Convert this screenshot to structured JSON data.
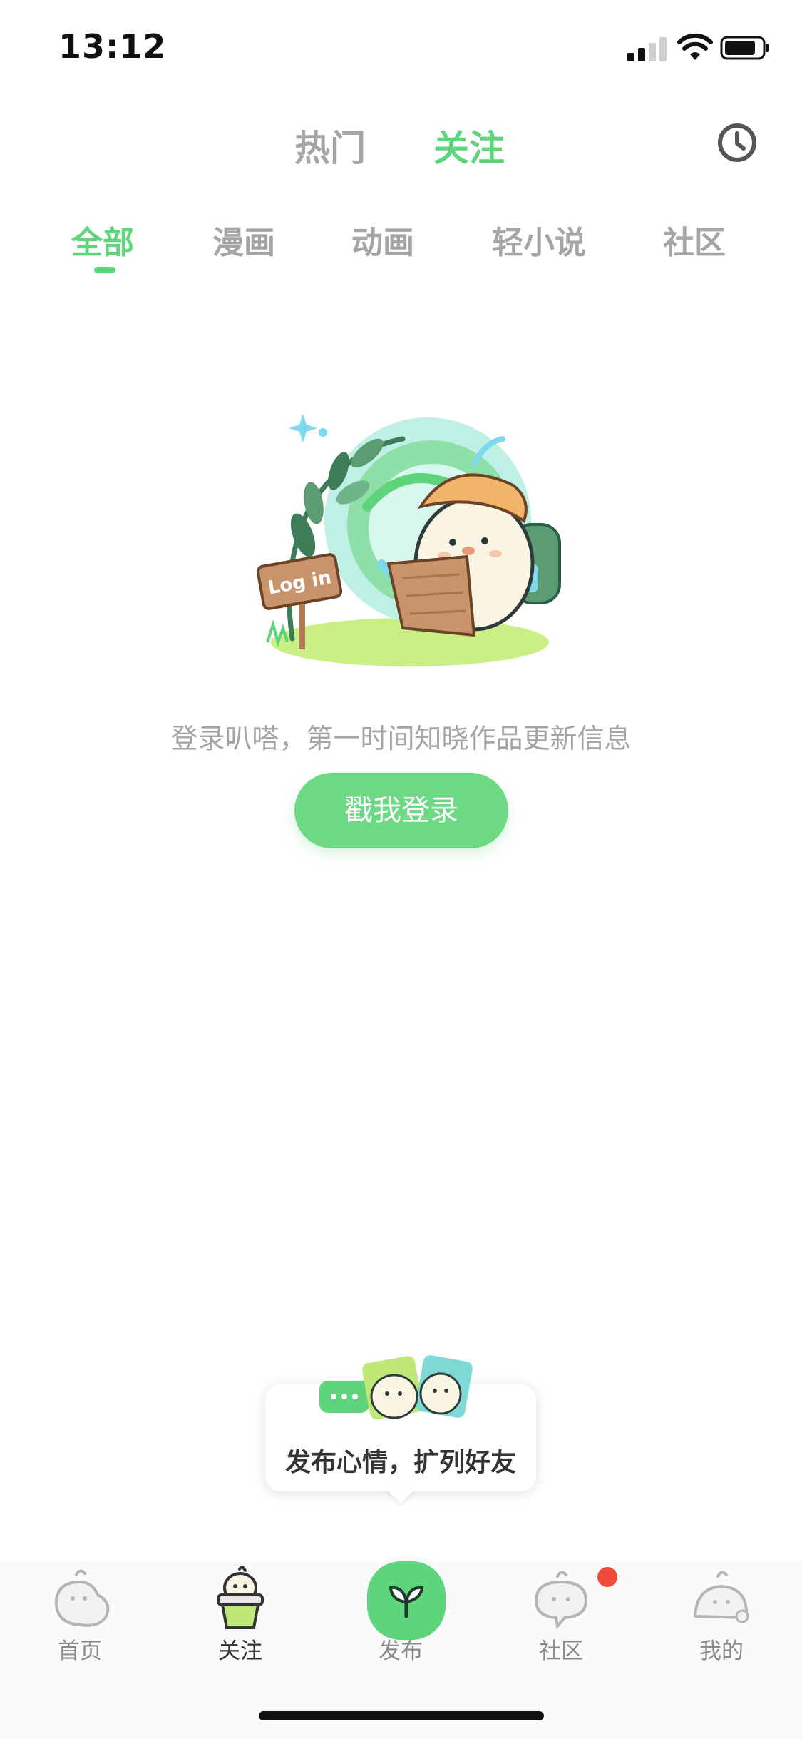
{
  "status_bar": {
    "time": "13:12"
  },
  "top_tabs": [
    {
      "label": "热门",
      "active": false
    },
    {
      "label": "关注",
      "active": true
    }
  ],
  "sub_tabs": [
    {
      "label": "全部",
      "active": true
    },
    {
      "label": "漫画",
      "active": false
    },
    {
      "label": "动画",
      "active": false
    },
    {
      "label": "轻小说",
      "active": false
    },
    {
      "label": "社区",
      "active": false
    }
  ],
  "empty_state": {
    "sign_text": "Log in",
    "message": "登录叭嗒，第一时间知晓作品更新信息",
    "button_label": "戳我登录"
  },
  "tooltip": {
    "text": "发布心情，扩列好友"
  },
  "bottom_nav": [
    {
      "label": "首页",
      "icon": "mascot-home-icon",
      "active": false
    },
    {
      "label": "关注",
      "icon": "mascot-pot-icon",
      "active": true
    },
    {
      "label": "发布",
      "icon": "sprout-icon",
      "active": false
    },
    {
      "label": "社区",
      "icon": "chat-bubble-mascot-icon",
      "active": false,
      "badge": true
    },
    {
      "label": "我的",
      "icon": "mascot-mine-icon",
      "active": false
    }
  ],
  "colors": {
    "accent": "#5ed47d",
    "inactive": "#a5a5a5",
    "badge": "#ef4b3a"
  }
}
